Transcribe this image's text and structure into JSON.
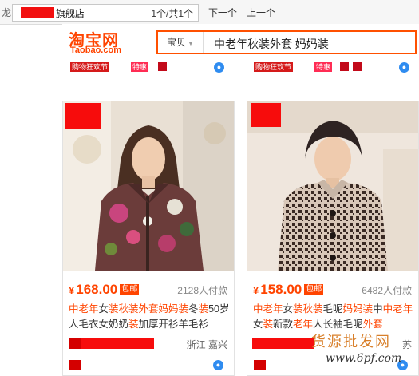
{
  "findbar": {
    "left_glyph": "龙",
    "query_suffix": "旗舰店",
    "match_count": "1个/共1个",
    "next_label": "下一个",
    "prev_label": "上一个"
  },
  "header": {
    "logo_cn": "淘宝网",
    "logo_en": "Taobao.com",
    "search_tab": "宝贝",
    "search_query": "中老年秋装外套 妈妈装"
  },
  "top_badges": {
    "left": [
      "购物狂欢节",
      "特惠"
    ],
    "right": [
      "购物狂欢节",
      "特惠"
    ]
  },
  "products": [
    {
      "currency": "¥",
      "price": "168.00",
      "shipping_badge": "包邮",
      "sold": "2128人付款",
      "title_parts": [
        {
          "t": "中老年",
          "hl": true
        },
        {
          "t": "女",
          "hl": false
        },
        {
          "t": "装秋装外套妈妈装",
          "hl": true
        },
        {
          "t": "冬",
          "hl": false
        },
        {
          "t": "装",
          "hl": true
        },
        {
          "t": "50岁人毛衣女奶奶",
          "hl": false
        },
        {
          "t": "装",
          "hl": true
        },
        {
          "t": "加厚开衫羊毛衫",
          "hl": false
        }
      ],
      "location": "浙江 嘉兴"
    },
    {
      "currency": "¥",
      "price": "158.00",
      "shipping_badge": "包邮",
      "sold": "6482人付款",
      "title_parts": [
        {
          "t": "中老年",
          "hl": true
        },
        {
          "t": "女",
          "hl": false
        },
        {
          "t": "装秋装",
          "hl": true
        },
        {
          "t": "毛呢",
          "hl": false
        },
        {
          "t": "妈妈装",
          "hl": true
        },
        {
          "t": "中",
          "hl": false
        },
        {
          "t": "中老年",
          "hl": true
        },
        {
          "t": "女",
          "hl": false
        },
        {
          "t": "装",
          "hl": true
        },
        {
          "t": "新款",
          "hl": false
        },
        {
          "t": "老年",
          "hl": true
        },
        {
          "t": "人长袖毛呢",
          "hl": false
        },
        {
          "t": "外套",
          "hl": true
        }
      ],
      "location": "苏"
    }
  ],
  "watermark": {
    "cn": "货源批发网",
    "url": "www.6pf.com"
  },
  "colors": {
    "accent": "#ff4400",
    "redaction": "#f20f0f"
  }
}
